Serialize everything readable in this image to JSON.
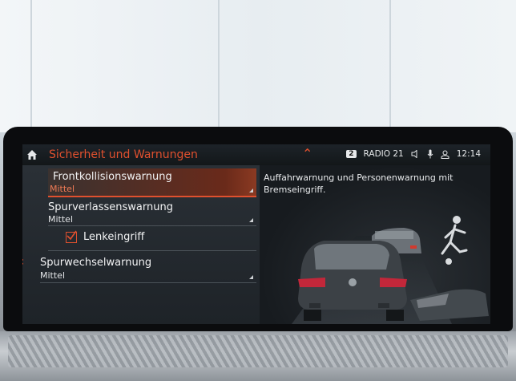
{
  "header": {
    "title": "Sicherheit und Warnungen",
    "station_badge": "2",
    "station": "RADIO 21",
    "time": "12:14"
  },
  "icons": {
    "home": "home-icon",
    "collapse": "chevron-up-icon",
    "volume": "speaker-icon",
    "mic": "microphone-icon",
    "user": "user-icon",
    "back": "chevron-left-icon"
  },
  "menu": {
    "items": [
      {
        "label": "Frontkollisionswarnung",
        "value": "Mittel"
      },
      {
        "label": "Spurverlassenswarnung",
        "value": "Mittel"
      },
      {
        "label": "Spurwechselwarnung",
        "value": "Mittel"
      }
    ],
    "checkbox": {
      "label": "Lenkeingriff",
      "checked": true
    }
  },
  "info": {
    "description": "Auffahrwarnung und Personenwarnung mit Bremseingriff."
  },
  "colors": {
    "accent": "#e0502e",
    "background": "#151a1f"
  }
}
